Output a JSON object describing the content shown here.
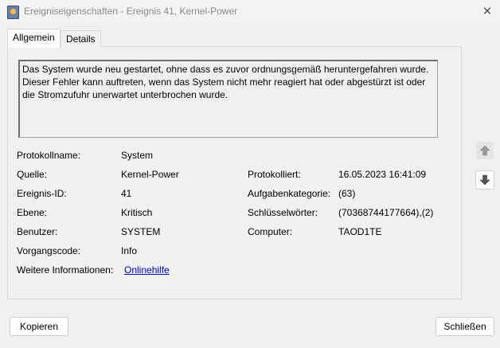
{
  "window": {
    "title": "Ereigniseigenschaften - Ereignis 41, Kernel-Power",
    "close_symbol": "✕"
  },
  "tabs": [
    {
      "label": "Allgemein",
      "active": true
    },
    {
      "label": "Details",
      "active": false
    }
  ],
  "description": "Das System wurde neu gestartet, ohne dass es zuvor ordnungsgemäß heruntergefahren wurde. Dieser Fehler kann auftreten, wenn das System nicht mehr reagiert hat oder abgestürzt ist oder die Stromzufuhr unerwartet unterbrochen wurde.",
  "fields": {
    "protokollname": {
      "label": "Protokollname:",
      "value": "System"
    },
    "quelle": {
      "label": "Quelle:",
      "value": "Kernel-Power"
    },
    "ereignis_id": {
      "label": "Ereignis-ID:",
      "value": "41"
    },
    "ebene": {
      "label": "Ebene:",
      "value": "Kritisch"
    },
    "benutzer": {
      "label": "Benutzer:",
      "value": "SYSTEM"
    },
    "vorgangscode": {
      "label": "Vorgangscode:",
      "value": "Info"
    },
    "weitere": {
      "label": "Weitere Informationen:",
      "value": "Onlinehilfe"
    },
    "protokolliert": {
      "label": "Protokolliert:",
      "value": "16.05.2023 16:41:09"
    },
    "aufgabenkategorie": {
      "label": "Aufgabenkategorie:",
      "value": "(63)"
    },
    "schluesselwoerter": {
      "label": "Schlüsselwörter:",
      "value": "(70368744177664),(2)"
    },
    "computer": {
      "label": "Computer:",
      "value": "TAOD1TE"
    }
  },
  "buttons": {
    "copy": "Kopieren",
    "close": "Schließen"
  },
  "icons": {
    "up": "arrow-up-icon",
    "down": "arrow-down-icon"
  }
}
